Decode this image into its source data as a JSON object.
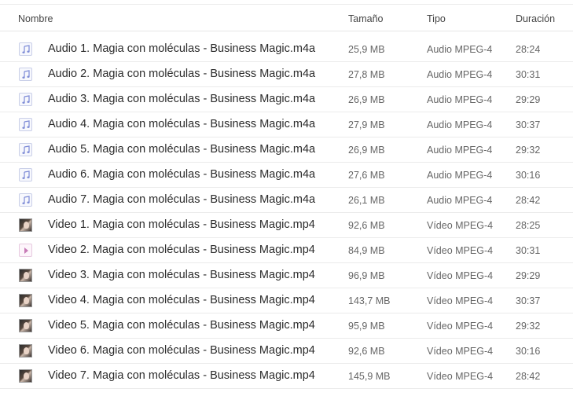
{
  "columns": {
    "name": "Nombre",
    "size": "Tamaño",
    "type": "Tipo",
    "duration": "Duración"
  },
  "files": [
    {
      "name": "Audio 1. Magia con moléculas - Business Magic.m4a",
      "size": "25,9 MB",
      "type": "Audio MPEG-4",
      "duration": "28:24",
      "icon": "audio-file-icon"
    },
    {
      "name": "Audio 2. Magia con moléculas - Business Magic.m4a",
      "size": "27,8 MB",
      "type": "Audio MPEG-4",
      "duration": "30:31",
      "icon": "audio-file-icon"
    },
    {
      "name": "Audio 3. Magia con moléculas - Business Magic.m4a",
      "size": "26,9 MB",
      "type": "Audio MPEG-4",
      "duration": "29:29",
      "icon": "audio-file-icon"
    },
    {
      "name": "Audio 4. Magia con moléculas - Business Magic.m4a",
      "size": "27,9 MB",
      "type": "Audio MPEG-4",
      "duration": "30:37",
      "icon": "audio-file-icon"
    },
    {
      "name": "Audio 5. Magia con moléculas - Business Magic.m4a",
      "size": "26,9 MB",
      "type": "Audio MPEG-4",
      "duration": "29:32",
      "icon": "audio-file-icon"
    },
    {
      "name": "Audio 6. Magia con moléculas - Business Magic.m4a",
      "size": "27,6 MB",
      "type": "Audio MPEG-4",
      "duration": "30:16",
      "icon": "audio-file-icon"
    },
    {
      "name": "Audio 7. Magia con moléculas - Business Magic.m4a",
      "size": "26,1 MB",
      "type": "Audio MPEG-4",
      "duration": "28:42",
      "icon": "audio-file-icon"
    },
    {
      "name": "Video 1. Magia con moléculas - Business Magic.mp4",
      "size": "92,6 MB",
      "type": "Vídeo MPEG-4",
      "duration": "28:25",
      "icon": "video-thumbnail-icon"
    },
    {
      "name": "Video 2. Magia con moléculas - Business Magic.mp4",
      "size": "84,9 MB",
      "type": "Vídeo MPEG-4",
      "duration": "30:31",
      "icon": "video-file-icon"
    },
    {
      "name": "Video 3. Magia con moléculas - Business Magic.mp4",
      "size": "96,9 MB",
      "type": "Vídeo MPEG-4",
      "duration": "29:29",
      "icon": "video-thumbnail-icon"
    },
    {
      "name": "Video 4. Magia con moléculas - Business Magic.mp4",
      "size": "143,7 MB",
      "type": "Vídeo MPEG-4",
      "duration": "30:37",
      "icon": "video-thumbnail-icon"
    },
    {
      "name": "Video 5. Magia con moléculas - Business Magic.mp4",
      "size": "95,9 MB",
      "type": "Vídeo MPEG-4",
      "duration": "29:32",
      "icon": "video-thumbnail-icon"
    },
    {
      "name": "Video 6. Magia con moléculas - Business Magic.mp4",
      "size": "92,6 MB",
      "type": "Vídeo MPEG-4",
      "duration": "30:16",
      "icon": "video-thumbnail-icon"
    },
    {
      "name": "Video 7. Magia con moléculas - Business Magic.mp4",
      "size": "145,9 MB",
      "type": "Vídeo MPEG-4",
      "duration": "28:42",
      "icon": "video-thumbnail-icon"
    }
  ]
}
